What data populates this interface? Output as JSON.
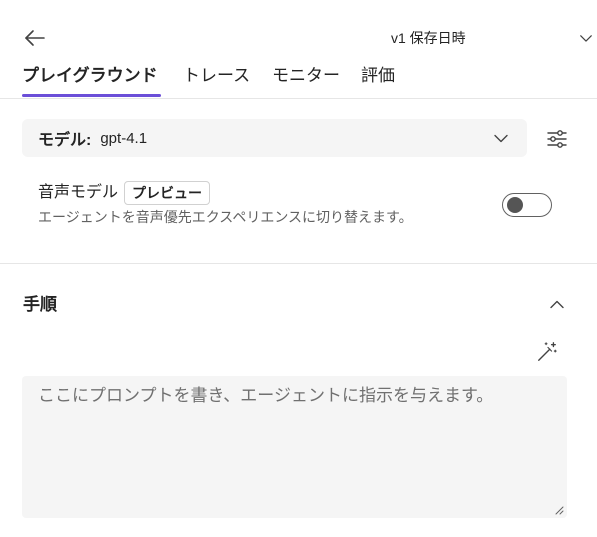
{
  "header": {
    "version_label": "v1 保存日時"
  },
  "tabs": [
    {
      "label": "プレイグラウンド",
      "selected": true
    },
    {
      "label": "トレース",
      "selected": false
    },
    {
      "label": "モニター",
      "selected": false
    },
    {
      "label": "評価",
      "selected": false
    }
  ],
  "model_selector": {
    "label": "モデル:",
    "value": "gpt-4.1"
  },
  "voice_model": {
    "title": "音声モデル",
    "badge": "プレビュー",
    "description": "エージェントを音声優先エクスペリエンスに切り替えます。",
    "enabled": false
  },
  "instructions": {
    "title": "手順",
    "placeholder": "ここにプロンプトを書き、エージェントに指示を与えます。",
    "expanded": true
  },
  "icons": {
    "back": "back-arrow-icon",
    "version_dropdown": "chevron-down-icon",
    "model_dropdown": "chevron-down-icon",
    "settings": "sliders-icon",
    "collapse": "chevron-up-icon",
    "generate": "magic-wand-icon",
    "resize": "resize-handle-icon"
  },
  "colors": {
    "accent": "#6b4fd8",
    "panel": "#f5f5f5",
    "divider": "#e6e6e6",
    "muted_text": "#616161"
  }
}
